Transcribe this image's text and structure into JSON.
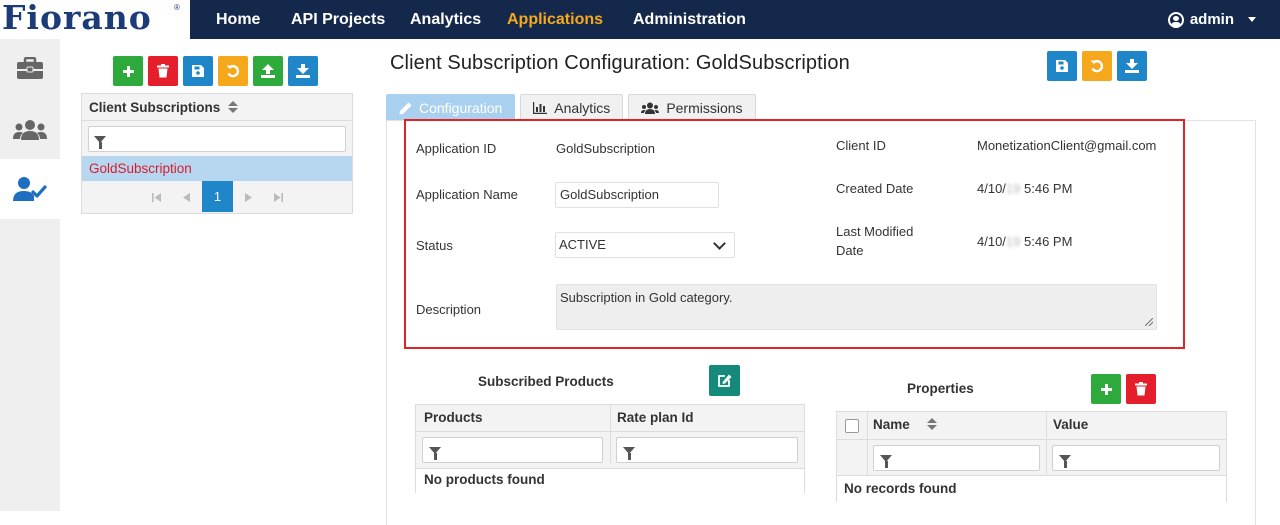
{
  "navbar": {
    "logo_text": "Fiorano",
    "logo_mark": "®",
    "items": [
      "Home",
      "API Projects",
      "Analytics",
      "Applications",
      "Administration"
    ],
    "active_item": "Applications",
    "user_label": "admin"
  },
  "rail": {
    "items": [
      "briefcase-icon",
      "users-icon",
      "user-check-icon"
    ],
    "active_item": "user-check-icon"
  },
  "list_toolbar": {
    "buttons": [
      {
        "name": "add",
        "color": "#2eaa3c"
      },
      {
        "name": "delete",
        "color": "#e41e2b"
      },
      {
        "name": "save",
        "color": "#1f86c9"
      },
      {
        "name": "revert",
        "color": "#f5a81c"
      },
      {
        "name": "import",
        "color": "#2eaa3c"
      },
      {
        "name": "export",
        "color": "#1f86c9"
      }
    ]
  },
  "subscriptions": {
    "header": "Client Subscriptions",
    "filter_placeholder": "",
    "rows": [
      "GoldSubscription"
    ],
    "selected_row": "GoldSubscription",
    "current_page": "1"
  },
  "page": {
    "title": "Client Subscription Configuration: GoldSubscription",
    "tabs": [
      "Configuration",
      "Analytics",
      "Permissions"
    ],
    "active_tab": "Configuration"
  },
  "config": {
    "application_id_label": "Application ID",
    "application_id_value": "GoldSubscription",
    "application_name_label": "Application Name",
    "application_name_value": "GoldSubscription",
    "status_label": "Status",
    "status_value": "ACTIVE",
    "description_label": "Description",
    "description_value": "Subscription in Gold category.",
    "client_id_label": "Client ID",
    "client_id_value": "MonetizationClient@gmail.com",
    "created_date_label": "Created Date",
    "created_date_prefix": "4/10/",
    "created_date_blurred": "19",
    "created_date_time": "5:46 PM",
    "modified_date_label_line1": "Last Modified",
    "modified_date_label_line2": "Date",
    "modified_date_prefix": "4/10/",
    "modified_date_blurred": "19",
    "modified_date_time": "5:46 PM"
  },
  "subscribed_products": {
    "title": "Subscribed Products",
    "columns": [
      "Products",
      "Rate plan Id"
    ],
    "empty_text": "No products found"
  },
  "properties": {
    "title": "Properties",
    "columns": [
      "Name",
      "Value"
    ],
    "empty_text": "No records found"
  },
  "colors": {
    "navbar_bg": "#14284b",
    "active_nav": "#f7a81b",
    "highlight_border": "#e02424",
    "selected_row_bg": "#b7d7f1",
    "selected_row_text": "#d91c2a"
  }
}
